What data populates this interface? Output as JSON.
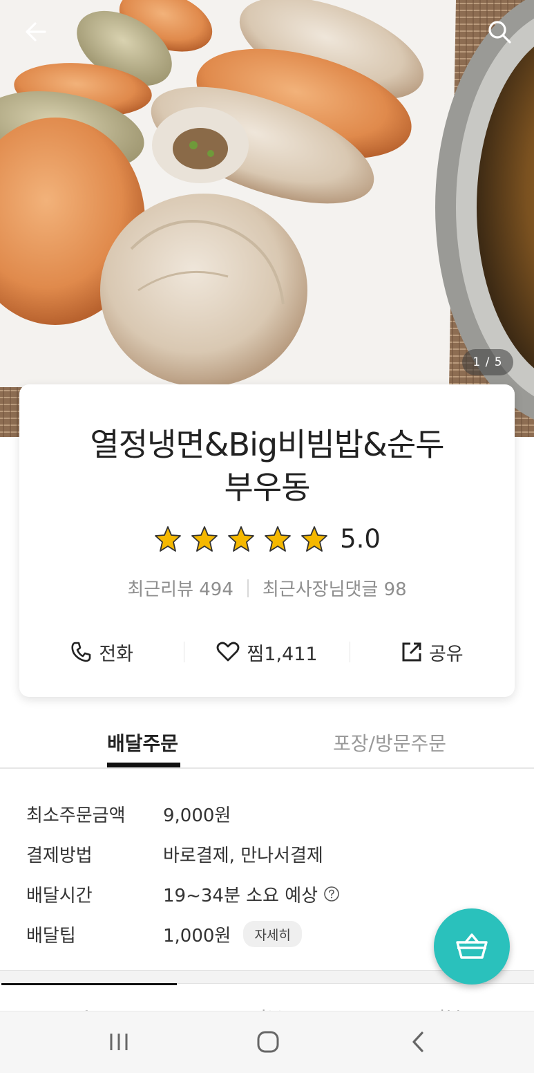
{
  "hero": {
    "image_description": "steamed dumplings on paper",
    "page_counter": "1 / 5"
  },
  "store": {
    "name_line1": "열정냉면&Big비빔밥&순두",
    "name_line2": "부우동",
    "rating": "5.0",
    "stars_filled": 5,
    "recent_reviews": "최근리뷰 494",
    "recent_owner_replies": "최근사장님댓글 98"
  },
  "actions": {
    "call": "전화",
    "like": "찜1,411",
    "share": "공유"
  },
  "order_tabs": {
    "delivery": "배달주문",
    "pickup": "포장/방문주문",
    "active": "delivery"
  },
  "info": {
    "min_order_label": "최소주문금액",
    "min_order_value": "9,000원",
    "payment_label": "결제방법",
    "payment_value": "바로결제, 만나서결제",
    "delivery_time_label": "배달시간",
    "delivery_time_value": "19~34분 소요 예상",
    "delivery_tip_label": "배달팁",
    "delivery_tip_value": "1,000원",
    "detail_button": "자세히"
  },
  "menu_tabs": [
    "메뉴",
    "정보",
    "리뷰"
  ],
  "colors": {
    "accent": "#2ac1bc",
    "star": "#f5b800",
    "text": "#222222",
    "muted": "#999999"
  }
}
